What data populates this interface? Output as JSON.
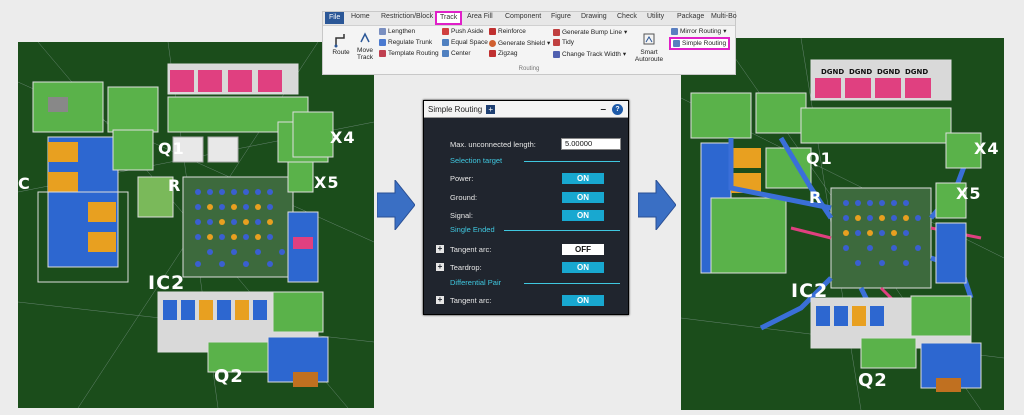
{
  "ribbon": {
    "tabs": [
      "File",
      "Home",
      "Restriction/Block",
      "Track",
      "Area Fill",
      "Component",
      "Figure",
      "Drawing",
      "Check",
      "Utility",
      "Package",
      "Multi-Bo"
    ],
    "active_tab": "Track",
    "big_buttons": {
      "route": "Route",
      "move_track_1": "Move",
      "move_track_2": "Track",
      "smart_1": "Smart",
      "smart_2": "Autoroute"
    },
    "items": {
      "lengthen": "Lengthen",
      "regulate_trunk": "Regulate Trunk",
      "template_routing": "Template Routing",
      "push_aside": "Push Aside",
      "equal_space": "Equal Space",
      "center": "Center",
      "reinforce": "Reinforce",
      "generate_shield": "Generate Shield",
      "zigzag": "Zigzag",
      "generate_bump_line": "Generate Bump Line",
      "tidy": "Tidy",
      "change_track_width": "Change Track Width",
      "mirror_routing": "Mirror Routing",
      "simple_routing": "Simple Routing"
    },
    "group_label": "Routing"
  },
  "panel": {
    "title": "Simple Routing",
    "max_unconnected_label": "Max. unconnected length:",
    "max_unconnected_value": "5.00000",
    "selection_target": "Selection target",
    "power_label": "Power:",
    "power_value": "ON",
    "ground_label": "Ground:",
    "ground_value": "ON",
    "signal_label": "Signal:",
    "signal_value": "ON",
    "single_ended": "Single Ended",
    "tangent_arc_label": "Tangent arc:",
    "tangent_arc_value": "OFF",
    "teardrop_label": "Teardrop:",
    "teardrop_value": "ON",
    "differential_pair": "Differential Pair",
    "dp_tangent_arc_label": "Tangent arc:",
    "dp_tangent_arc_value": "ON"
  },
  "left_board": {
    "q1": "Q1",
    "x4": "X4",
    "x5": "X5",
    "ic2": "IC2",
    "q2": "Q2",
    "c": "C",
    "r": "R"
  },
  "right_board": {
    "q1": "Q1",
    "x4": "X4",
    "x5": "X5",
    "ic2": "IC2",
    "q2": "Q2",
    "r": "R",
    "dgnd": "DGND"
  },
  "colors": {
    "board": "#1b4d1b",
    "accent": "#e020c8",
    "toggle_on": "#18a8d0",
    "arrow": "#3a6fc4"
  }
}
